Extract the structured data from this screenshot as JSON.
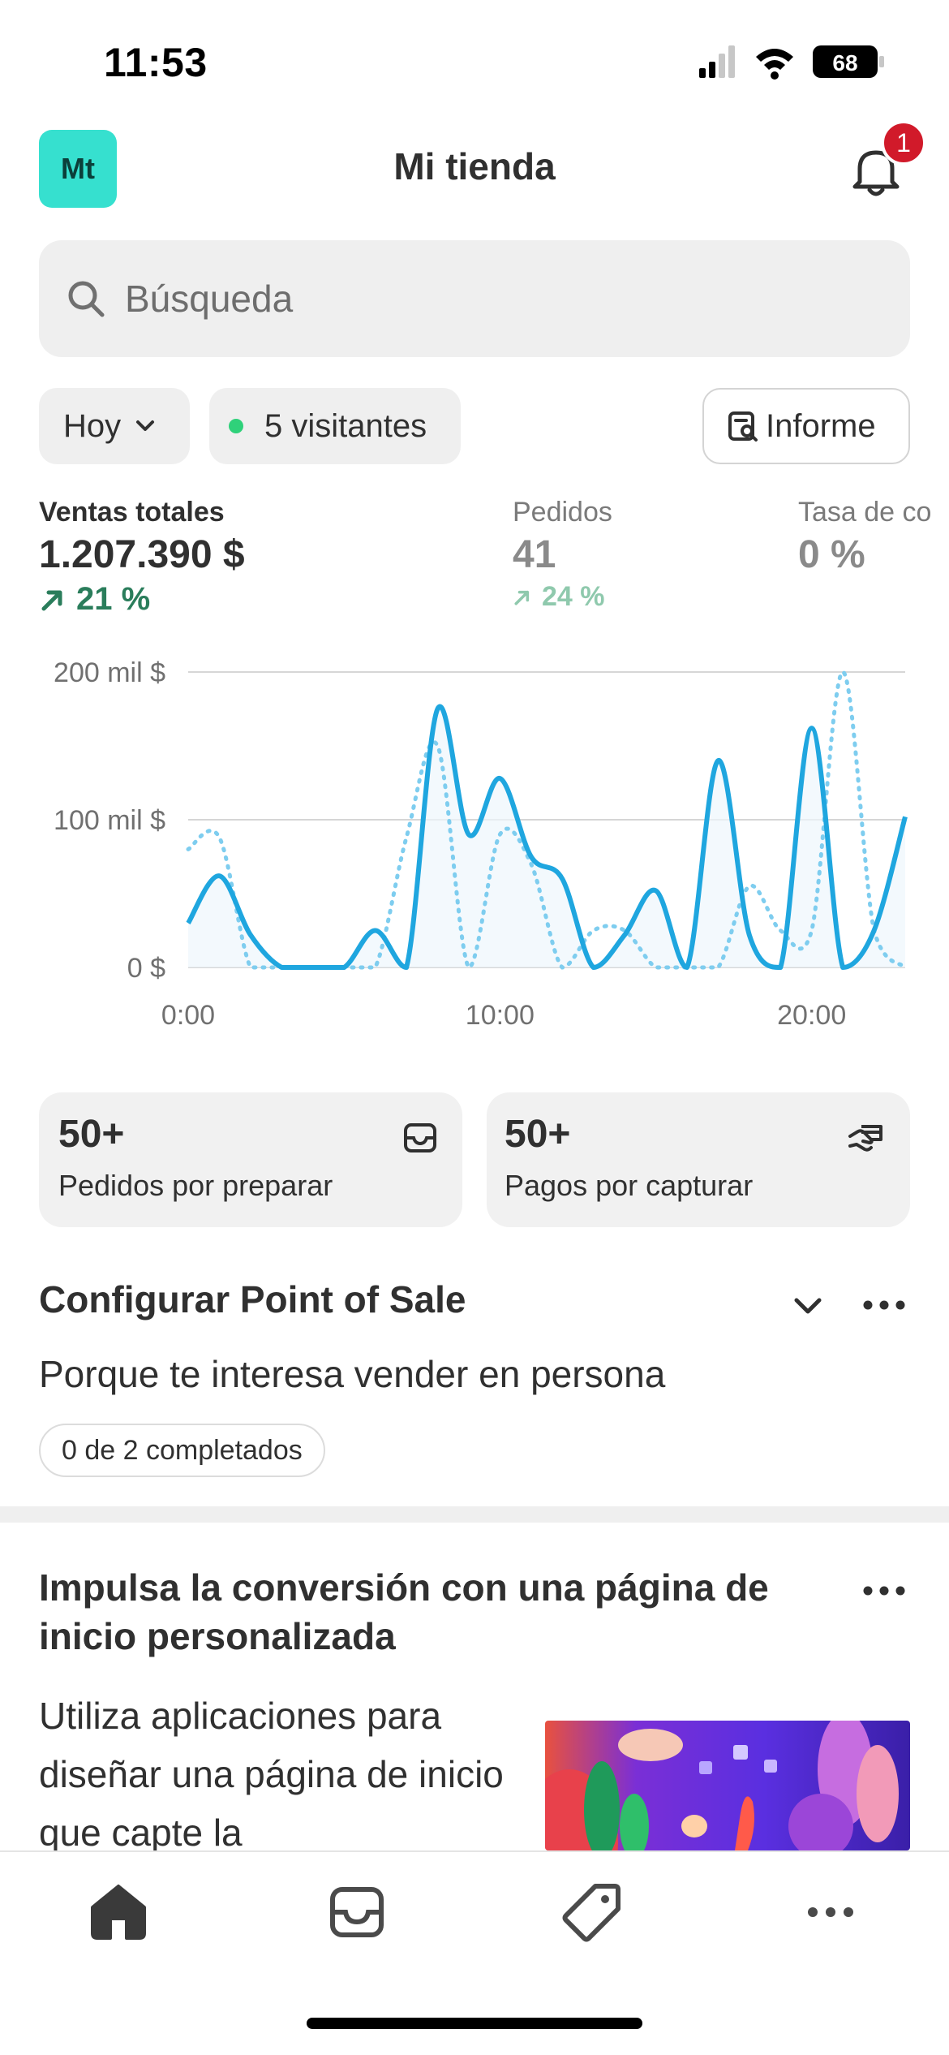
{
  "status_bar": {
    "time": "11:53",
    "battery": "68"
  },
  "header": {
    "avatar_initials": "Mt",
    "title": "Mi tienda",
    "notification_count": "1"
  },
  "search": {
    "placeholder": "Búsqueda"
  },
  "filters": {
    "date": "Hoy",
    "visitors": "5 visitantes",
    "report": "Informe"
  },
  "metrics": [
    {
      "label": "Ventas totales",
      "value": "1.207.390 $",
      "delta": "21 %"
    },
    {
      "label": "Pedidos",
      "value": "41",
      "delta": "24 %"
    },
    {
      "label": "Tasa de co",
      "value": "0 %"
    }
  ],
  "chart_data": {
    "type": "line",
    "x_ticks": [
      "0:00",
      "10:00",
      "20:00"
    ],
    "y_ticks": [
      "200 mil $",
      "100 mil $",
      "0 $"
    ],
    "ylim": [
      0,
      200
    ],
    "x": [
      0,
      1,
      2,
      3,
      4,
      5,
      6,
      7,
      8,
      9,
      10,
      11,
      12,
      13,
      14,
      15,
      16,
      17,
      18,
      19,
      20,
      21,
      22,
      23
    ],
    "series": [
      {
        "style": "solid",
        "values": [
          30,
          62,
          22,
          0,
          0,
          0,
          25,
          0,
          175,
          90,
          128,
          75,
          60,
          0,
          22,
          52,
          0,
          140,
          22,
          0,
          162,
          0,
          25,
          102
        ]
      },
      {
        "style": "dotted",
        "values": [
          80,
          88,
          0,
          0,
          0,
          0,
          0,
          88,
          150,
          0,
          90,
          70,
          0,
          25,
          25,
          0,
          0,
          0,
          55,
          25,
          25,
          200,
          25,
          0
        ]
      }
    ],
    "grid": true,
    "colors": {
      "solid": "#1fa6df",
      "dotted": "#7ecdef"
    }
  },
  "cards": [
    {
      "count": "50+",
      "label": "Pedidos por preparar",
      "icon": "inbox-icon"
    },
    {
      "count": "50+",
      "label": "Pagos por capturar",
      "icon": "hand-card-icon"
    }
  ],
  "setup": {
    "title": "Configurar Point of Sale",
    "text": "Porque te interesa vender en persona",
    "progress": "0 de 2 completados"
  },
  "promo": {
    "title": "Impulsa la conversión con una página de inicio personalizada",
    "text": "Utiliza aplicaciones para diseñar una página de inicio que capte la"
  },
  "nav": [
    "home-icon",
    "orders-icon",
    "products-icon",
    "more-icon"
  ],
  "colors": {
    "accent_teal": "#36e0cf",
    "positive": "#2a7d5b",
    "badge": "#d11a2a"
  }
}
